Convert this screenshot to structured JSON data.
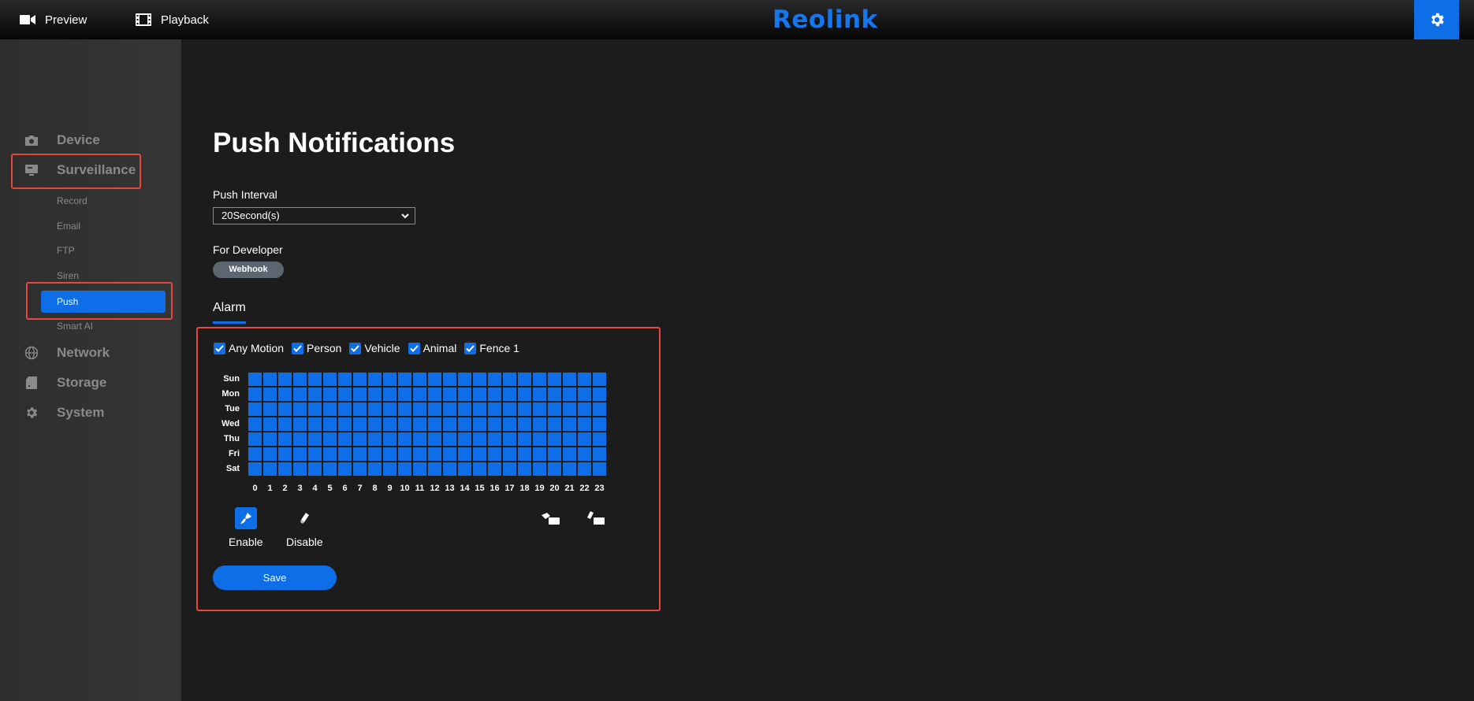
{
  "topbar": {
    "preview_label": "Preview",
    "playback_label": "Playback",
    "logo_text": "Reolink",
    "accent_color": "#0e6ee8"
  },
  "sidebar": {
    "device": "Device",
    "surveillance": "Surveillance",
    "sub_items": [
      "Record",
      "Email",
      "FTP",
      "Siren",
      "Push",
      "Smart AI"
    ],
    "network": "Network",
    "storage": "Storage",
    "system": "System",
    "active_item": "Push"
  },
  "main": {
    "title": "Push Notifications",
    "push_interval_label": "Push Interval",
    "push_interval_value": "20Second(s)",
    "developer_label": "For Developer",
    "webhook_label": "Webhook",
    "alarm_tab": "Alarm",
    "checkboxes": [
      {
        "label": "Any Motion",
        "checked": true
      },
      {
        "label": "Person",
        "checked": true
      },
      {
        "label": "Vehicle",
        "checked": true
      },
      {
        "label": "Animal",
        "checked": true
      },
      {
        "label": "Fence 1",
        "checked": true
      }
    ],
    "days": [
      "Sun",
      "Mon",
      "Tue",
      "Wed",
      "Thu",
      "Fri",
      "Sat"
    ],
    "hours": [
      "0",
      "1",
      "2",
      "3",
      "4",
      "5",
      "6",
      "7",
      "8",
      "9",
      "10",
      "11",
      "12",
      "13",
      "14",
      "15",
      "16",
      "17",
      "18",
      "19",
      "20",
      "21",
      "22",
      "23"
    ],
    "enable_label": "Enable",
    "disable_label": "Disable",
    "save_label": "Save"
  }
}
